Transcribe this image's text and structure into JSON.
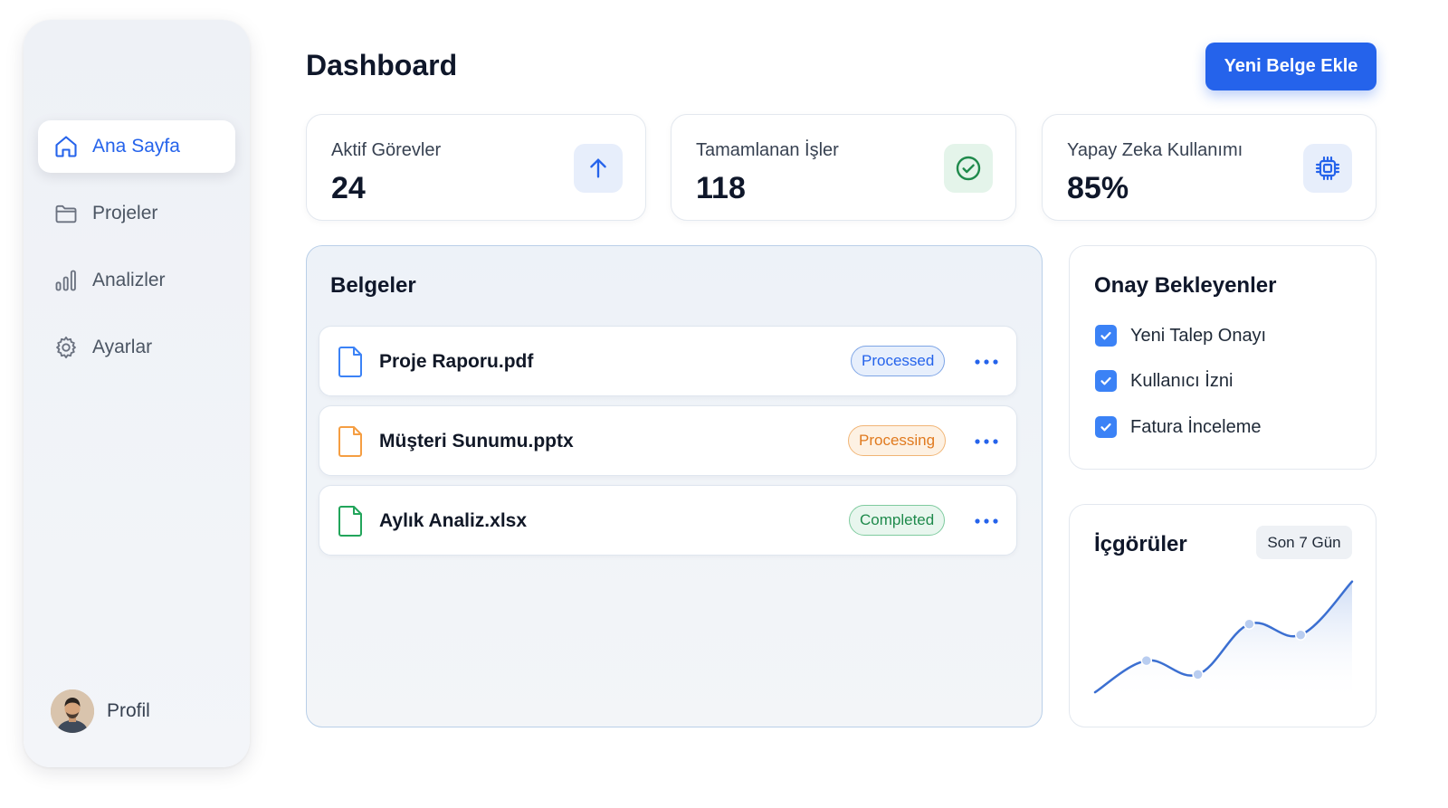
{
  "sidebar": {
    "items": [
      {
        "label": "Ana Sayfa",
        "icon": "home-icon",
        "active": true
      },
      {
        "label": "Projeler",
        "icon": "folder-icon",
        "active": false
      },
      {
        "label": "Analizler",
        "icon": "bar-chart-icon",
        "active": false
      },
      {
        "label": "Ayarlar",
        "icon": "gear-icon",
        "active": false
      }
    ],
    "profile_label": "Profil"
  },
  "header": {
    "title": "Dashboard",
    "primary_button": "Yeni Belge Ekle"
  },
  "stats": [
    {
      "label": "Aktif Görevler",
      "value": "24",
      "icon": "arrow-up-icon"
    },
    {
      "label": "Tamamlanan İşler",
      "value": "118",
      "icon": "check-circle-icon"
    },
    {
      "label": "Yapay Zeka Kullanımı",
      "value": "85%",
      "icon": "cpu-chip-icon"
    }
  ],
  "documents": {
    "title": "Belgeler",
    "rows": [
      {
        "name": "Proje Raporu.pdf",
        "status": "Processed",
        "status_color": "#2563eb",
        "icon_color": "#3b82f6"
      },
      {
        "name": "Müşteri Sunumu.pptx",
        "status": "Processing",
        "status_color": "#e07a1f",
        "icon_color": "#f59e42"
      },
      {
        "name": "Aylık Analiz.xlsx",
        "status": "Completed",
        "status_color": "#1f8a4c",
        "icon_color": "#22a55b"
      }
    ]
  },
  "approvals": {
    "title": "Onay Bekleyenler",
    "items": [
      {
        "label": "Yeni Talep Onayı",
        "checked": true
      },
      {
        "label": "Kullanıcı İzni",
        "checked": true
      },
      {
        "label": "Fatura İnceleme",
        "checked": true
      }
    ]
  },
  "insights": {
    "title": "İçgörüler",
    "range": "Son 7 Gün"
  },
  "chart_data": {
    "type": "area",
    "x": [
      1,
      2,
      3,
      4,
      5,
      6
    ],
    "series": [
      {
        "values": [
          10,
          42,
          28,
          79,
          68,
          122
        ]
      }
    ],
    "ylim": [
      0,
      130
    ],
    "marked_points": [
      1,
      2,
      3,
      4
    ],
    "grid": false,
    "color": "#3b6fd1"
  },
  "colors": {
    "accent": "#2563eb",
    "sidebar_bg": "#eef1f6",
    "success": "#22a55b",
    "warning": "#f59e42"
  }
}
